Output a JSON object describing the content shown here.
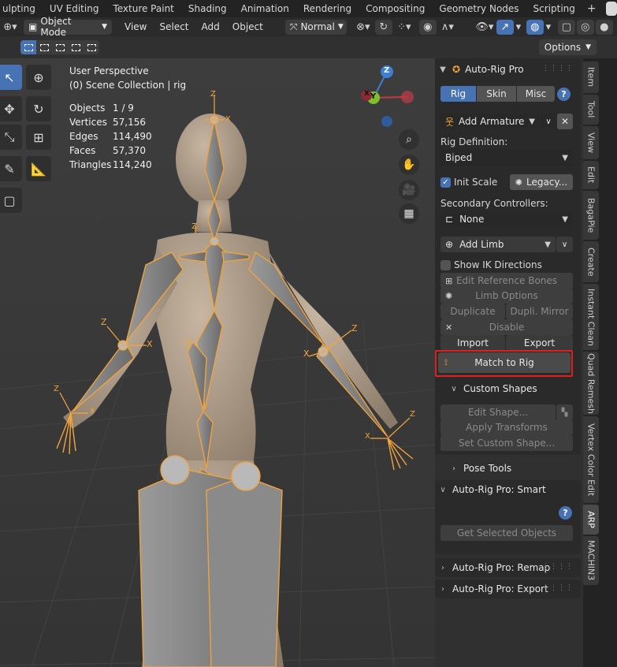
{
  "workspace_tabs": [
    "ulpting",
    "UV Editing",
    "Texture Paint",
    "Shading",
    "Animation",
    "Rendering",
    "Compositing",
    "Geometry Nodes",
    "Scripting"
  ],
  "header": {
    "mode": "Object Mode",
    "menus": [
      "View",
      "Select",
      "Add",
      "Object"
    ],
    "transform_orientation": "Normal",
    "options_label": "Options"
  },
  "viewport": {
    "perspective": "User Perspective",
    "collection": "(0) Scene Collection | rig",
    "stats": [
      {
        "label": "Objects",
        "value": "1 / 9"
      },
      {
        "label": "Vertices",
        "value": "57,156"
      },
      {
        "label": "Edges",
        "value": "114,490"
      },
      {
        "label": "Faces",
        "value": "57,370"
      },
      {
        "label": "Triangles",
        "value": "114,240"
      }
    ],
    "gizmo": {
      "z": "Z",
      "y": "Y",
      "x": "X"
    },
    "axis_labels": [
      "Z",
      "X",
      "Z",
      "X",
      "Z",
      "X",
      "Z",
      "X",
      "Z",
      "X",
      "Z",
      "X"
    ]
  },
  "panel": {
    "title": "Auto-Rig Pro",
    "tabs": [
      "Rig",
      "Skin",
      "Misc"
    ],
    "active_tab": "Rig",
    "add_armature": "Add Armature",
    "rig_definition_label": "Rig Definition:",
    "rig_definition_value": "Biped",
    "init_scale": "Init Scale",
    "legacy": "Legacy...",
    "secondary_label": "Secondary Controllers:",
    "secondary_value": "None",
    "add_limb": "Add Limb",
    "show_ik": "Show IK Directions",
    "edit_ref_bones": "Edit Reference Bones",
    "limb_options": "Limb Options",
    "duplicate": "Duplicate",
    "dupli_mirror": "Dupli. Mirror",
    "disable": "Disable",
    "import": "Import",
    "export": "Export",
    "match_to_rig": "Match to Rig",
    "custom_shapes": "Custom Shapes",
    "edit_shape": "Edit Shape...",
    "apply_transforms": "Apply Transforms",
    "set_custom_shape": "Set Custom Shape...",
    "pose_tools": "Pose Tools",
    "smart_title": "Auto-Rig Pro: Smart",
    "get_selected": "Get Selected Objects",
    "remap_title": "Auto-Rig Pro: Remap",
    "export_title": "Auto-Rig Pro: Export"
  },
  "side_tabs": [
    "Item",
    "Tool",
    "View",
    "Edit",
    "BagaPie",
    "Create",
    "Instant Clean",
    "Quad Remesh",
    "Vertex Color Edit",
    "ARP",
    "MACHIN3"
  ],
  "active_side_tab": "ARP",
  "colors": {
    "accent": "#4772b3",
    "highlight": "#e02020",
    "bone": "#f5a43a",
    "skin": "#b2a08c"
  }
}
